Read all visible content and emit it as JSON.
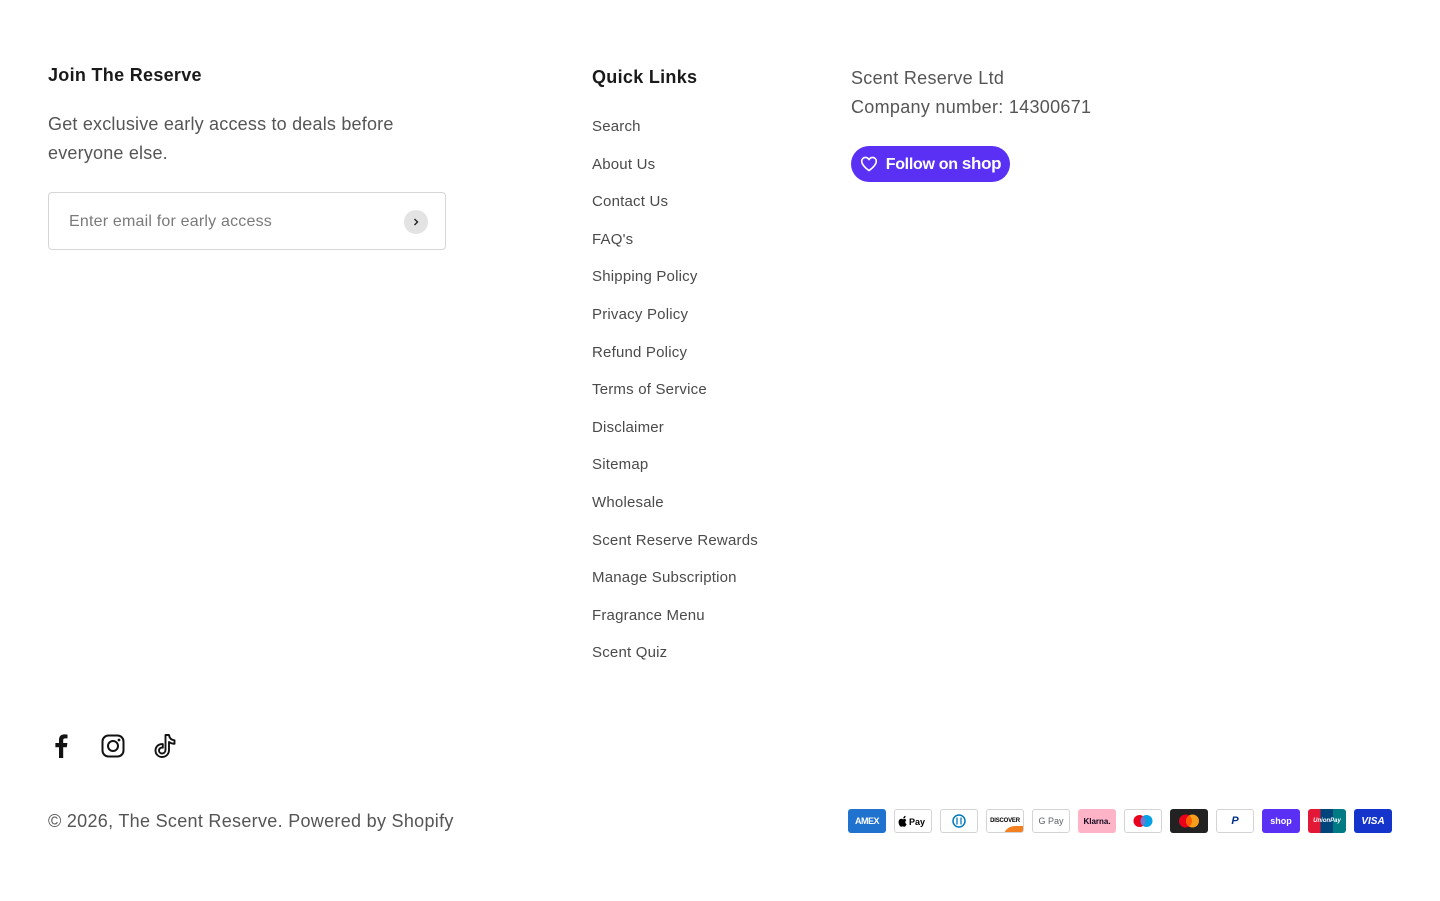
{
  "newsletter": {
    "heading": "Join The Reserve",
    "text": "Get exclusive early access to deals before everyone else.",
    "placeholder": "Enter email for early access"
  },
  "quick_links": {
    "heading": "Quick Links",
    "items": [
      {
        "label": "Search"
      },
      {
        "label": "About Us"
      },
      {
        "label": "Contact Us"
      },
      {
        "label": "FAQ's"
      },
      {
        "label": "Shipping Policy"
      },
      {
        "label": "Privacy Policy"
      },
      {
        "label": "Refund Policy"
      },
      {
        "label": "Terms of Service"
      },
      {
        "label": "Disclaimer"
      },
      {
        "label": "Sitemap"
      },
      {
        "label": "Wholesale"
      },
      {
        "label": "Scent Reserve Rewards"
      },
      {
        "label": "Manage Subscription"
      },
      {
        "label": "Fragrance Menu"
      },
      {
        "label": "Scent Quiz"
      }
    ]
  },
  "company": {
    "name": "Scent Reserve Ltd",
    "number": "Company number: 14300671",
    "follow_prefix": "Follow on",
    "follow_brand": "shop",
    "follow_color": "#5a31f4"
  },
  "social": [
    "facebook-icon",
    "instagram-icon",
    "tiktok-icon"
  ],
  "footer": {
    "copyright_prefix": "© 2026, ",
    "store_name": "The Scent Reserve",
    "separator": ". ",
    "powered_by": "Powered by Shopify"
  },
  "payments": {
    "amex": "AMEX",
    "discover": "DISCOVER",
    "google_pay": "G Pay",
    "klarna": "Klarna.",
    "paypal": "P",
    "shop_pay": "shop",
    "unionpay": "UnionPay",
    "visa": "VISA"
  }
}
